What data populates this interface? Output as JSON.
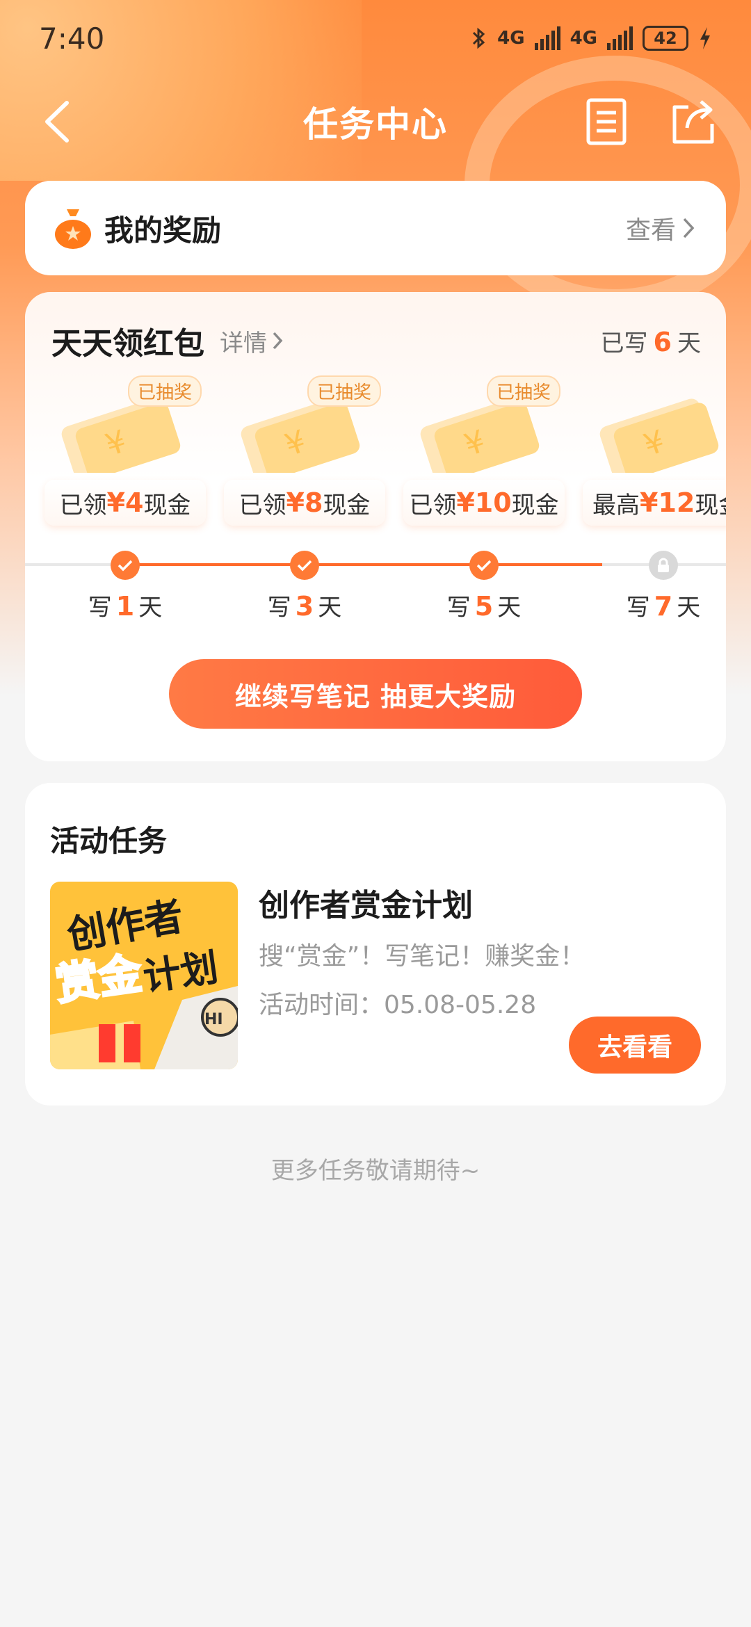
{
  "status_bar": {
    "time": "7:40",
    "network_1": "4G",
    "network_2": "4G",
    "battery": "42"
  },
  "nav": {
    "title": "任务中心"
  },
  "reward": {
    "title": "我的奖励",
    "view_label": "查看"
  },
  "daily": {
    "title": "天天领红包",
    "detail_label": "详情",
    "streak_prefix": "已写",
    "streak_days": "6",
    "streak_suffix": "天",
    "prizes": [
      {
        "tag": "已抽奖",
        "prefix": "已领",
        "amount": "¥4",
        "suffix": "现金",
        "day_prefix": "写",
        "day": "1",
        "day_suffix": "天"
      },
      {
        "tag": "已抽奖",
        "prefix": "已领",
        "amount": "¥8",
        "suffix": "现金",
        "day_prefix": "写",
        "day": "3",
        "day_suffix": "天"
      },
      {
        "tag": "已抽奖",
        "prefix": "已领",
        "amount": "¥10",
        "suffix": "现金",
        "day_prefix": "写",
        "day": "5",
        "day_suffix": "天"
      },
      {
        "tag": "",
        "prefix": "最高",
        "amount": "¥12",
        "suffix": "现金",
        "day_prefix": "写",
        "day": "7",
        "day_suffix": "天"
      }
    ],
    "cta_label": "继续写笔记 抽更大奖励"
  },
  "tasks": {
    "section_title": "活动任务",
    "items": [
      {
        "name": "创作者赏金计划",
        "description": "搜“赏金”！写笔记！赚奖金！",
        "time_label": "活动时间：05.08-05.28",
        "button_label": "去看看",
        "thumb_text_top": "创作者",
        "thumb_text_bottom_1": "赏金",
        "thumb_text_bottom_2": "计划",
        "thumb_badge": "HI"
      }
    ]
  },
  "footer": {
    "note": "更多任务敬请期待~"
  },
  "colors": {
    "accent": "#ff6a2b",
    "header_gradient_top": "#ff8a3d",
    "background": "#f5f5f5"
  }
}
